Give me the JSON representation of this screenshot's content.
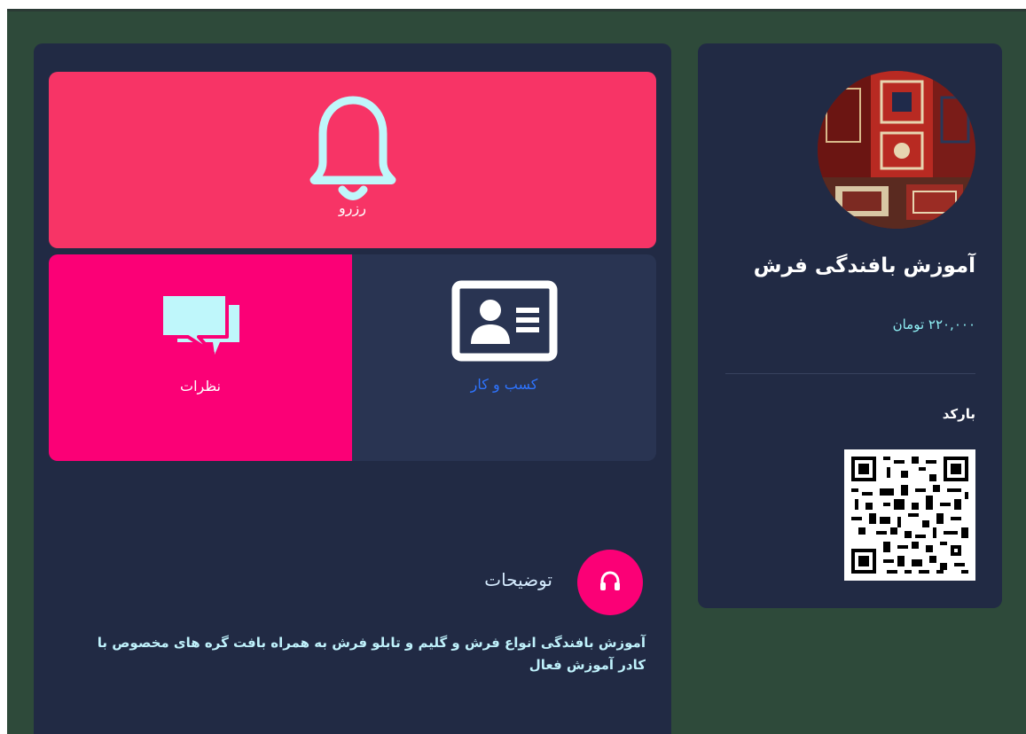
{
  "tiles": {
    "reserve_label": "رزرو",
    "comments_label": "نظرات",
    "business_label": "کسب و کار"
  },
  "description": {
    "title": "توضیحات",
    "text": "آموزش بافندگی انواع فرش و گلیم و تابلو فرش به همراه بافت گره های مخصوص با کادر آموزش فعال"
  },
  "product": {
    "title": "آموزش بافندگی فرش",
    "price": "۲۲۰,۰۰۰ تومان",
    "barcode_label": "بارکد"
  },
  "colors": {
    "page_bg": "#2e4a3a",
    "card_bg": "#212a44",
    "reserve": "#f73466",
    "comments": "#fb0076",
    "business": "#293452",
    "icon": "#bff7fb",
    "business_text": "#2e74ff"
  },
  "icons": {
    "reserve": "bell-icon",
    "comments": "chat-bubbles-icon",
    "business": "id-card-icon",
    "description": "headset-icon"
  }
}
